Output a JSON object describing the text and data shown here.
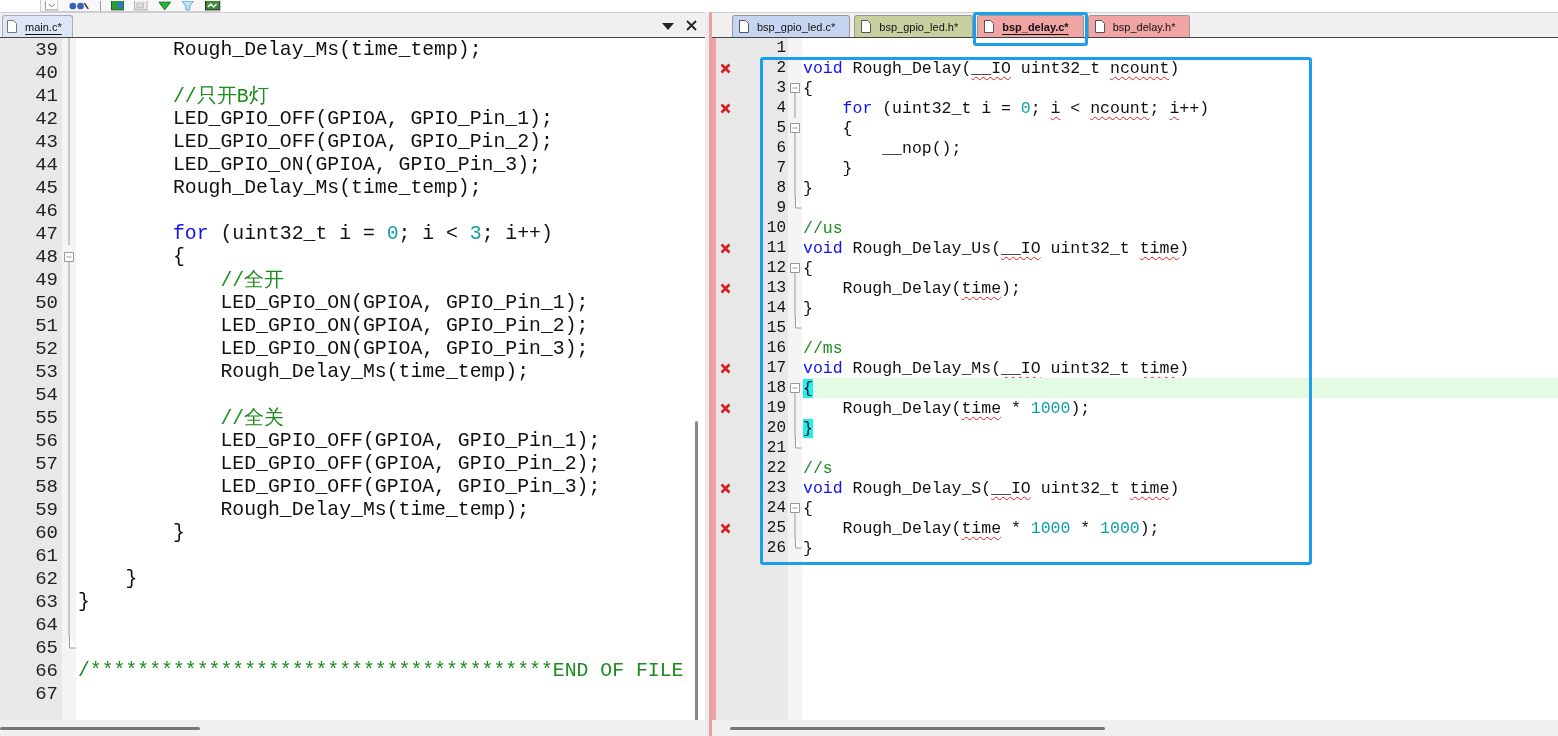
{
  "left_editor": {
    "tabs": [
      {
        "label": "main.c*",
        "selected": true,
        "color": "#dce6f6"
      }
    ],
    "lines": [
      {
        "number": "39",
        "kind": "fold-body",
        "tokens": [
          {
            "kind": "plain",
            "text": "        Rough_Delay_Ms(time_temp);"
          }
        ]
      },
      {
        "number": "40",
        "kind": "fold-body"
      },
      {
        "number": "41",
        "kind": "fold-body",
        "tokens": [
          {
            "kind": "comment",
            "text": "        //只开B灯"
          }
        ]
      },
      {
        "number": "42",
        "kind": "fold-body",
        "tokens": [
          {
            "kind": "plain",
            "text": "        LED_GPIO_OFF(GPIOA, GPIO_Pin_1);"
          }
        ]
      },
      {
        "number": "43",
        "kind": "fold-body",
        "tokens": [
          {
            "kind": "plain",
            "text": "        LED_GPIO_OFF(GPIOA, GPIO_Pin_2);"
          }
        ]
      },
      {
        "number": "44",
        "kind": "fold-body",
        "tokens": [
          {
            "kind": "plain",
            "text": "        LED_GPIO_ON(GPIOA, GPIO_Pin_3);"
          }
        ]
      },
      {
        "number": "45",
        "kind": "fold-body",
        "tokens": [
          {
            "kind": "plain",
            "text": "        Rough_Delay_Ms(time_temp);"
          }
        ]
      },
      {
        "number": "46",
        "kind": "fold-body"
      },
      {
        "number": "47",
        "kind": "fold-body",
        "tokens": [
          {
            "kind": "keyword",
            "text": "        for"
          },
          {
            "kind": "plain",
            "text": " (uint32_t i = "
          },
          {
            "kind": "number",
            "text": "0"
          },
          {
            "kind": "plain",
            "text": "; i < "
          },
          {
            "kind": "number",
            "text": "3"
          },
          {
            "kind": "plain",
            "text": "; i++)"
          }
        ]
      },
      {
        "number": "48",
        "kind": "fold-start",
        "tokens": [
          {
            "kind": "plain",
            "text": "        {"
          }
        ]
      },
      {
        "number": "49",
        "kind": "fold-body",
        "tokens": [
          {
            "kind": "comment",
            "text": "            //全开"
          }
        ]
      },
      {
        "number": "50",
        "kind": "fold-body",
        "tokens": [
          {
            "kind": "plain",
            "text": "            LED_GPIO_ON(GPIOA, GPIO_Pin_1);"
          }
        ]
      },
      {
        "number": "51",
        "kind": "fold-body",
        "tokens": [
          {
            "kind": "plain",
            "text": "            LED_GPIO_ON(GPIOA, GPIO_Pin_2);"
          }
        ]
      },
      {
        "number": "52",
        "kind": "fold-body",
        "tokens": [
          {
            "kind": "plain",
            "text": "            LED_GPIO_ON(GPIOA, GPIO_Pin_3);"
          }
        ]
      },
      {
        "number": "53",
        "kind": "fold-body",
        "tokens": [
          {
            "kind": "plain",
            "text": "            Rough_Delay_Ms(time_temp);"
          }
        ]
      },
      {
        "number": "54",
        "kind": "fold-body"
      },
      {
        "number": "55",
        "kind": "fold-body",
        "tokens": [
          {
            "kind": "comment",
            "text": "            //全关"
          }
        ]
      },
      {
        "number": "56",
        "kind": "fold-body",
        "tokens": [
          {
            "kind": "plain",
            "text": "            LED_GPIO_OFF(GPIOA, GPIO_Pin_1);"
          }
        ]
      },
      {
        "number": "57",
        "kind": "fold-body",
        "tokens": [
          {
            "kind": "plain",
            "text": "            LED_GPIO_OFF(GPIOA, GPIO_Pin_2);"
          }
        ]
      },
      {
        "number": "58",
        "kind": "fold-body",
        "tokens": [
          {
            "kind": "plain",
            "text": "            LED_GPIO_OFF(GPIOA, GPIO_Pin_3);"
          }
        ]
      },
      {
        "number": "59",
        "kind": "fold-body",
        "tokens": [
          {
            "kind": "plain",
            "text": "            Rough_Delay_Ms(time_temp);"
          }
        ]
      },
      {
        "number": "60",
        "kind": "fold-body",
        "tokens": [
          {
            "kind": "plain",
            "text": "        }"
          }
        ]
      },
      {
        "number": "61",
        "kind": "fold-body"
      },
      {
        "number": "62",
        "kind": "fold-body",
        "tokens": [
          {
            "kind": "plain",
            "text": "    }"
          }
        ]
      },
      {
        "number": "63",
        "kind": "fold-body",
        "tokens": [
          {
            "kind": "plain",
            "text": "}"
          }
        ]
      },
      {
        "number": "64",
        "kind": "fold-body"
      },
      {
        "number": "65",
        "kind": "fold-end"
      },
      {
        "number": "66",
        "kind": "plain",
        "tokens": [
          {
            "kind": "comment",
            "text": "/***************************************END OF FILE"
          }
        ]
      },
      {
        "number": "67",
        "kind": "plain"
      }
    ]
  },
  "right_editor": {
    "tabs": [
      {
        "label": "bsp_gpio_led.c*",
        "selected": false,
        "color": "#c6d6f2"
      },
      {
        "label": "bsp_gpio_led.h*",
        "selected": false,
        "color": "#c8d0a0"
      },
      {
        "label": "bsp_delay.c*",
        "selected": true,
        "color": "#f0a4a4"
      },
      {
        "label": "bsp_delay.h*",
        "selected": false,
        "color": "#f0a4a4"
      }
    ],
    "lines": [
      {
        "number": "1",
        "kind": "plain",
        "error": false,
        "current": false
      },
      {
        "number": "2",
        "kind": "plain",
        "error": true,
        "current": false,
        "tokens": [
          {
            "kind": "keyword",
            "text": "void"
          },
          {
            "kind": "plain",
            "text": " Rough_Delay("
          },
          {
            "kind": "flagged",
            "text": "__IO"
          },
          {
            "kind": "plain",
            "text": " uint32_t "
          },
          {
            "kind": "flagged",
            "text": "ncount"
          },
          {
            "kind": "plain",
            "text": ")"
          }
        ]
      },
      {
        "number": "3",
        "kind": "fold-start",
        "error": false,
        "current": false,
        "tokens": [
          {
            "kind": "plain",
            "text": "{"
          }
        ]
      },
      {
        "number": "4",
        "kind": "fold-body",
        "error": true,
        "current": false,
        "tokens": [
          {
            "kind": "keyword",
            "text": "    for"
          },
          {
            "kind": "plain",
            "text": " (uint32_t i = "
          },
          {
            "kind": "number",
            "text": "0"
          },
          {
            "kind": "plain",
            "text": "; "
          },
          {
            "kind": "flagged",
            "text": "i"
          },
          {
            "kind": "plain",
            "text": " < "
          },
          {
            "kind": "flagged",
            "text": "ncount"
          },
          {
            "kind": "plain",
            "text": "; "
          },
          {
            "kind": "flagged",
            "text": "i"
          },
          {
            "kind": "plain",
            "text": "++)"
          }
        ]
      },
      {
        "number": "5",
        "kind": "fold-start",
        "error": false,
        "current": false,
        "tokens": [
          {
            "kind": "plain",
            "text": "    {"
          }
        ]
      },
      {
        "number": "6",
        "kind": "fold-body",
        "error": false,
        "current": false,
        "tokens": [
          {
            "kind": "plain",
            "text": "        __nop();"
          }
        ]
      },
      {
        "number": "7",
        "kind": "fold-body",
        "error": false,
        "current": false,
        "tokens": [
          {
            "kind": "plain",
            "text": "    }"
          }
        ]
      },
      {
        "number": "8",
        "kind": "fold-body",
        "error": false,
        "current": false,
        "tokens": [
          {
            "kind": "plain",
            "text": "}"
          }
        ]
      },
      {
        "number": "9",
        "kind": "fold-end",
        "error": false,
        "current": false
      },
      {
        "number": "10",
        "kind": "plain",
        "error": false,
        "current": false,
        "tokens": [
          {
            "kind": "comment",
            "text": "//us"
          }
        ]
      },
      {
        "number": "11",
        "kind": "plain",
        "error": true,
        "current": false,
        "tokens": [
          {
            "kind": "keyword",
            "text": "void"
          },
          {
            "kind": "plain",
            "text": " Rough_Delay_Us("
          },
          {
            "kind": "flagged",
            "text": "__IO"
          },
          {
            "kind": "plain",
            "text": " uint32_t "
          },
          {
            "kind": "flagged",
            "text": "time"
          },
          {
            "kind": "plain",
            "text": ")"
          }
        ]
      },
      {
        "number": "12",
        "kind": "fold-start",
        "error": false,
        "current": false,
        "tokens": [
          {
            "kind": "plain",
            "text": "{"
          }
        ]
      },
      {
        "number": "13",
        "kind": "fold-body",
        "error": true,
        "current": false,
        "tokens": [
          {
            "kind": "plain",
            "text": "    Rough_Delay("
          },
          {
            "kind": "flagged",
            "text": "time"
          },
          {
            "kind": "plain",
            "text": ");"
          }
        ]
      },
      {
        "number": "14",
        "kind": "fold-body",
        "error": false,
        "current": false,
        "tokens": [
          {
            "kind": "plain",
            "text": "}"
          }
        ]
      },
      {
        "number": "15",
        "kind": "fold-end",
        "error": false,
        "current": false
      },
      {
        "number": "16",
        "kind": "plain",
        "error": false,
        "current": false,
        "tokens": [
          {
            "kind": "comment",
            "text": "//ms"
          }
        ]
      },
      {
        "number": "17",
        "kind": "plain",
        "error": true,
        "current": false,
        "tokens": [
          {
            "kind": "keyword",
            "text": "void"
          },
          {
            "kind": "plain",
            "text": " Rough_Delay_Ms("
          },
          {
            "kind": "flagged",
            "text": "__IO"
          },
          {
            "kind": "plain",
            "text": " uint32_t "
          },
          {
            "kind": "flagged",
            "text": "time"
          },
          {
            "kind": "plain",
            "text": ")"
          }
        ]
      },
      {
        "number": "18",
        "kind": "fold-start",
        "error": false,
        "current": true,
        "tokens": [
          {
            "kind": "brace-match",
            "text": "{"
          }
        ]
      },
      {
        "number": "19",
        "kind": "fold-body",
        "error": true,
        "current": false,
        "tokens": [
          {
            "kind": "plain",
            "text": "    Rough_Delay("
          },
          {
            "kind": "flagged",
            "text": "time"
          },
          {
            "kind": "plain",
            "text": " * "
          },
          {
            "kind": "number",
            "text": "1000"
          },
          {
            "kind": "plain",
            "text": ");"
          }
        ]
      },
      {
        "number": "20",
        "kind": "fold-body",
        "error": false,
        "current": false,
        "tokens": [
          {
            "kind": "brace-match",
            "text": "}"
          }
        ]
      },
      {
        "number": "21",
        "kind": "fold-end",
        "error": false,
        "current": false
      },
      {
        "number": "22",
        "kind": "plain",
        "error": false,
        "current": false,
        "tokens": [
          {
            "kind": "comment",
            "text": "//s"
          }
        ]
      },
      {
        "number": "23",
        "kind": "plain",
        "error": true,
        "current": false,
        "tokens": [
          {
            "kind": "keyword",
            "text": "void"
          },
          {
            "kind": "plain",
            "text": " Rough_Delay_S("
          },
          {
            "kind": "flagged",
            "text": "__IO"
          },
          {
            "kind": "plain",
            "text": " uint32_t "
          },
          {
            "kind": "flagged",
            "text": "time"
          },
          {
            "kind": "plain",
            "text": ")"
          }
        ]
      },
      {
        "number": "24",
        "kind": "fold-start",
        "error": false,
        "current": false,
        "tokens": [
          {
            "kind": "plain",
            "text": "{"
          }
        ]
      },
      {
        "number": "25",
        "kind": "fold-body",
        "error": true,
        "current": false,
        "tokens": [
          {
            "kind": "plain",
            "text": "    Rough_Delay("
          },
          {
            "kind": "flagged",
            "text": "time"
          },
          {
            "kind": "plain",
            "text": " * "
          },
          {
            "kind": "number",
            "text": "1000"
          },
          {
            "kind": "plain",
            "text": " * "
          },
          {
            "kind": "number",
            "text": "1000"
          },
          {
            "kind": "plain",
            "text": ");"
          }
        ]
      },
      {
        "number": "26",
        "kind": "fold-end",
        "error": false,
        "current": false,
        "tokens": [
          {
            "kind": "plain",
            "text": "}"
          }
        ]
      }
    ]
  }
}
